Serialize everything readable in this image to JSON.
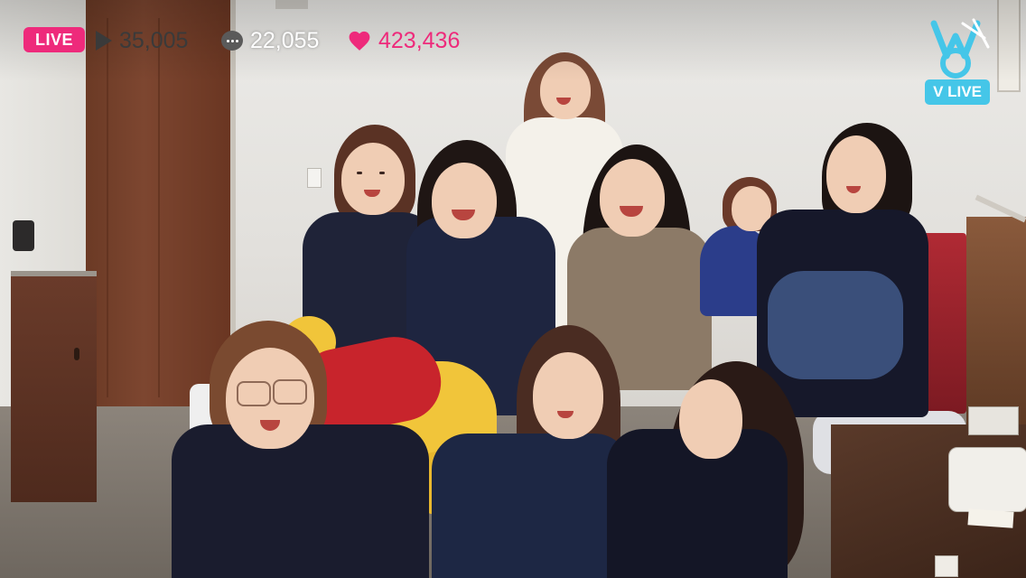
{
  "stream": {
    "live_label": "LIVE",
    "views": "35,005",
    "comments": "22,055",
    "likes": "423,436"
  },
  "brand": {
    "logo_text": "V LIVE",
    "accent_color": "#ee2a7b",
    "logo_color": "#45c6e8"
  },
  "icons": {
    "views": "play-icon",
    "comments": "chat-bubble-icon",
    "likes": "heart-icon"
  }
}
